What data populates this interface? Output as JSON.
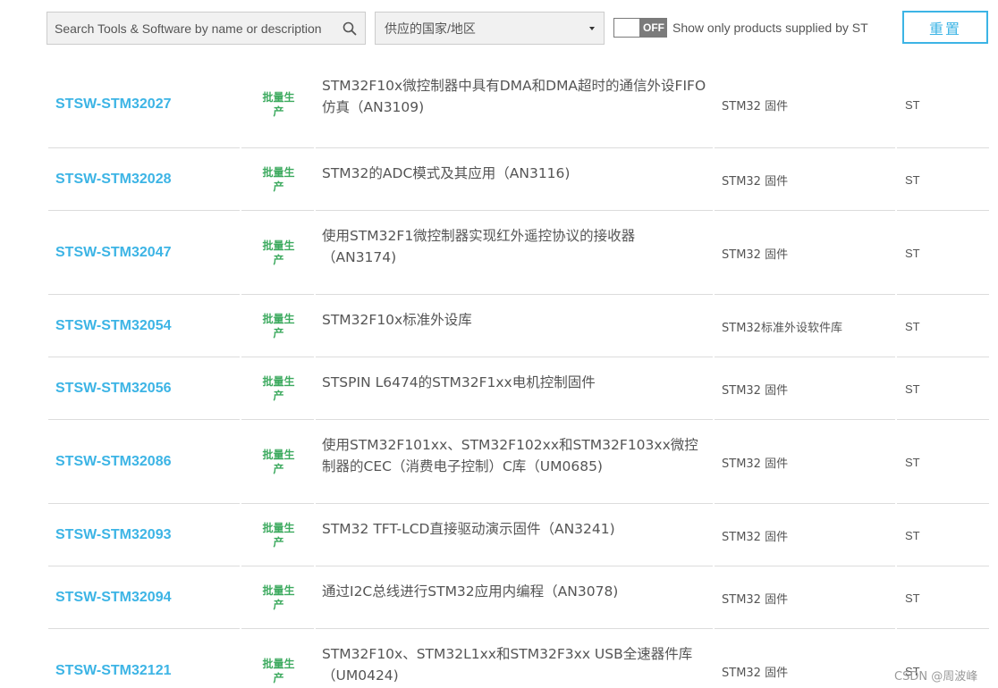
{
  "toolbar": {
    "search_placeholder": "Search Tools & Software by name or description",
    "search_icon": "search-icon",
    "region_value": "供应的国家/地区",
    "toggle_state": "OFF",
    "toggle_label": "Show only products supplied by ST",
    "reset_label": "重置"
  },
  "colors": {
    "accent": "#3cb4e5",
    "status_green": "#3daa5f",
    "text": "#555555",
    "toggle_bg": "#7b7b7b"
  },
  "rows": [
    {
      "id": "STSW-STM32027",
      "status": "批量生产",
      "description": "STM32F10x微控制器中具有DMA和DMA超时的通信外设FIFO仿真（AN3109)",
      "type": "STM32 固件",
      "supplier": "ST"
    },
    {
      "id": "STSW-STM32028",
      "status": "批量生产",
      "description": "STM32的ADC模式及其应用（AN3116)",
      "type": "STM32 固件",
      "supplier": "ST"
    },
    {
      "id": "STSW-STM32047",
      "status": "批量生产",
      "description": "使用STM32F1微控制器实现红外遥控协议的接收器（AN3174)",
      "type": "STM32 固件",
      "supplier": "ST"
    },
    {
      "id": "STSW-STM32054",
      "status": "批量生产",
      "description": "STM32F10x标准外设库",
      "type": "STM32标准外设软件库",
      "supplier": "ST"
    },
    {
      "id": "STSW-STM32056",
      "status": "批量生产",
      "description": "STSPIN L6474的STM32F1xx电机控制固件",
      "type": "STM32 固件",
      "supplier": "ST"
    },
    {
      "id": "STSW-STM32086",
      "status": "批量生产",
      "description": "使用STM32F101xx、STM32F102xx和STM32F103xx微控制器的CEC（消费电子控制）C库（UM0685)",
      "type": "STM32 固件",
      "supplier": "ST"
    },
    {
      "id": "STSW-STM32093",
      "status": "批量生产",
      "description": "STM32 TFT-LCD直接驱动演示固件（AN3241)",
      "type": "STM32 固件",
      "supplier": "ST"
    },
    {
      "id": "STSW-STM32094",
      "status": "批量生产",
      "description": "通过I2C总线进行STM32应用内编程（AN3078)",
      "type": "STM32 固件",
      "supplier": "ST"
    },
    {
      "id": "STSW-STM32121",
      "status": "批量生产",
      "description": "STM32F10x、STM32L1xx和STM32F3xx USB全速器件库（UM0424)",
      "type": "STM32 固件",
      "supplier": "ST"
    }
  ],
  "watermark": "CSDN @周波峰"
}
